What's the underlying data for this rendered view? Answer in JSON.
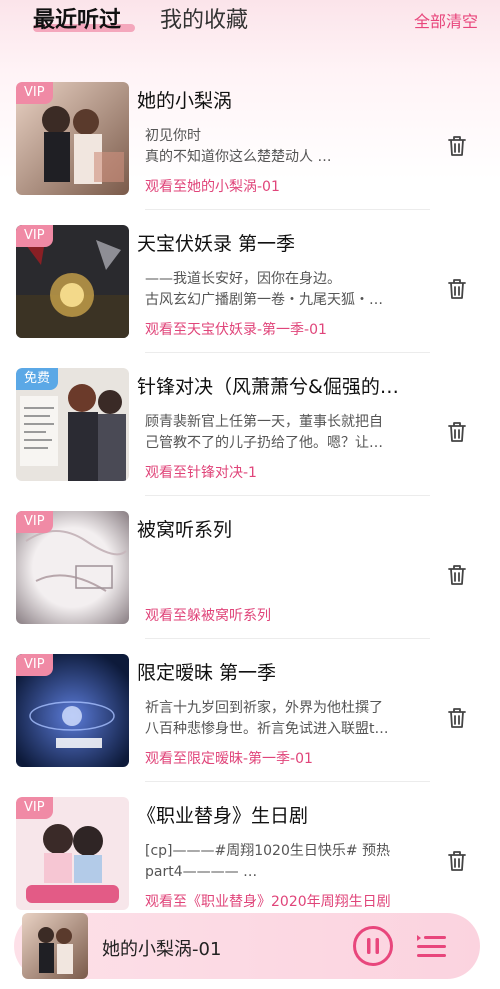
{
  "header": {
    "tab_recent": "最近听过",
    "tab_favorites": "我的收藏",
    "clear_all": "全部清空"
  },
  "items": [
    {
      "badge": "VIP",
      "badge_type": "vip",
      "title": "她的小梨涡",
      "desc": [
        "初见你时",
        "真的不知道你这么楚楚动人 …"
      ],
      "progress": "观看至她的小梨涡-01",
      "cover_colors": [
        "#7a5a4a",
        "#e9d2c4"
      ]
    },
    {
      "badge": "VIP",
      "badge_type": "vip",
      "title": "天宝伏妖录 第一季",
      "desc": [
        "——我道长安好，因你在身边。",
        "古风玄幻广播剧第一卷・九尾天狐・…"
      ],
      "progress": "观看至天宝伏妖录-第一季-01",
      "cover_colors": [
        "#2a2a2e",
        "#c9a24a"
      ]
    },
    {
      "badge": "免费",
      "badge_type": "free",
      "title": "针锋对决（风萧萧兮&倔强的…",
      "desc": [
        "顾青裴新官上任第一天，董事长就把自",
        "己管教不了的儿子扔给了他。嗯？让…"
      ],
      "progress": "观看至针锋对决-1",
      "cover_colors": [
        "#e8e4df",
        "#6b3a2a"
      ]
    },
    {
      "badge": "VIP",
      "badge_type": "vip",
      "title": "被窝听系列",
      "desc": [],
      "progress": "观看至躲被窝听系列",
      "cover_colors": [
        "#d8d0d2",
        "#8a7f84"
      ]
    },
    {
      "badge": "VIP",
      "badge_type": "vip",
      "title": "限定暧昧 第一季",
      "desc": [
        "祈言十九岁回到祈家，外界为他杜撰了",
        "八百种悲惨身世。祈言免试进入联盟t…"
      ],
      "progress": "观看至限定暧昧-第一季-01",
      "cover_colors": [
        "#0d1a3a",
        "#5b7bd8"
      ]
    },
    {
      "badge": "VIP",
      "badge_type": "vip",
      "title": "《职业替身》生日剧",
      "desc": [
        "[cp]———#周翔1020生日快乐# 预热",
        "part4———— …"
      ],
      "progress": "观看至《职业替身》2020年周翔生日剧",
      "cover_colors": [
        "#f7e6ea",
        "#e35b86"
      ]
    }
  ],
  "player": {
    "now_playing": "她的小梨涡-01",
    "accent": "#e8467c"
  }
}
